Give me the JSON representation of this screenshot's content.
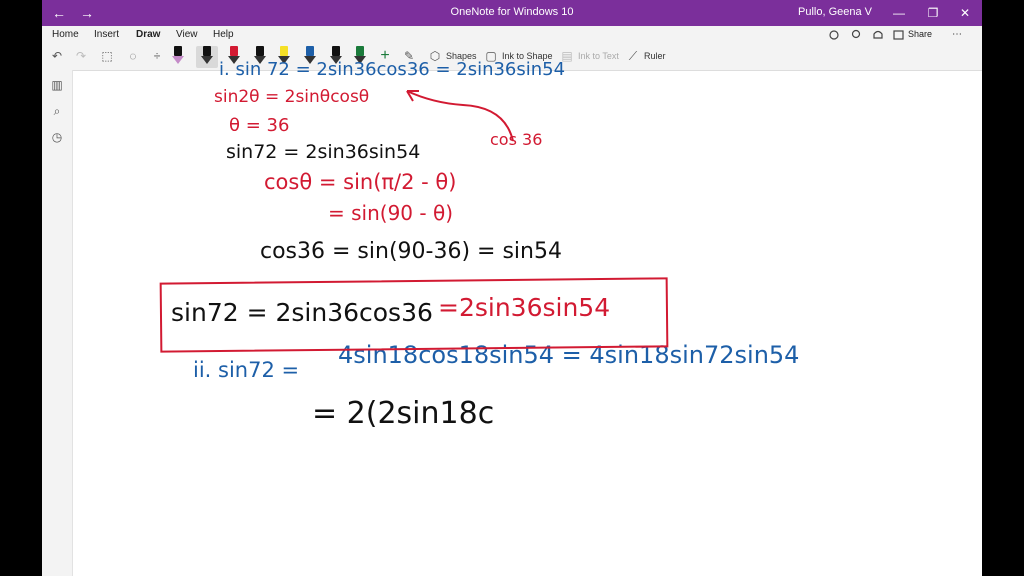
{
  "titlebar": {
    "back": "←",
    "forward": "→",
    "title": "OneNote for Windows 10",
    "user": "Pullo, Geena V",
    "minimize": "—",
    "maximize": "❐",
    "close": "✕"
  },
  "menu": {
    "tabs": [
      "Home",
      "Insert",
      "Draw",
      "View",
      "Help"
    ],
    "active": "Draw"
  },
  "ribbon": {
    "shapes_label": "Shapes",
    "ink_to_shape_label": "Ink to Shape",
    "ink_to_text_label": "Ink to Text",
    "ruler_label": "Ruler",
    "pen_colors": [
      "#111111",
      "#111111",
      "#d21a32",
      "#111111",
      "#f5e026",
      "#1d5fa8",
      "#111111",
      "#1a7a3a"
    ]
  },
  "notes": {
    "line_top_partial": "i. sin 72 = 2sin36cos36 = 2sin36sin54",
    "line_sin2theta": "sin2θ = 2sinθcosθ",
    "line_theta": "θ = 36",
    "annotation_cos36": "cos 36",
    "line_sin72": "sin72 = 2sin36sin54",
    "line_cos_theta": "cosθ = sin(π/2 - θ)",
    "line_sin90": "= sin(90 - θ)",
    "line_cos36": "cos36 = sin(90-36) = sin54",
    "boxed_black": "sin72 = 2sin36cos36",
    "boxed_red": "=2sin36sin54",
    "line_ii_label": "ii. sin72 =",
    "line_ii_blue": "4sin18cos18sin54 = 4sin18sin72sin54",
    "line_last": "= 2(2sin18c"
  },
  "colors": {
    "titlebar": "#7b2f9b",
    "red_ink": "#d21a32",
    "black_ink": "#111111",
    "blue_ink": "#1d5fa8"
  }
}
